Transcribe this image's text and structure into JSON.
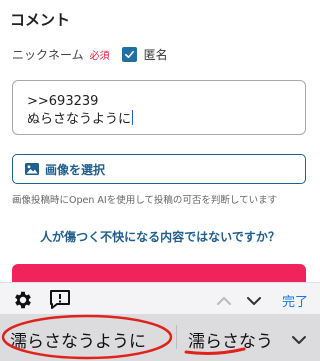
{
  "form": {
    "section_title": "コメント",
    "nickname_label": "ニックネーム",
    "required_badge": "必須",
    "anonymous_label": "匿名",
    "anonymous_checked": true,
    "comment_lines": [
      ">>693239",
      "ぬらさなうように"
    ],
    "select_image_label": "画像を選択",
    "notice_text": "画像投稿時にOpen AIを使用して投稿の可否を判断しています",
    "harm_link_text": "人が傷つく不快になる内容ではないですか？",
    "accent_color": "#f0245a",
    "link_color": "#1f5f8e"
  },
  "keyboard": {
    "toolbar_icons": [
      "gear-icon",
      "feedback-icon",
      "chevron-up-icon",
      "chevron-down-icon"
    ],
    "done_label": "完了",
    "candidates": [
      "濡らさなうように",
      "濡らさなう"
    ],
    "expand_icon": "chevron-down-icon"
  }
}
